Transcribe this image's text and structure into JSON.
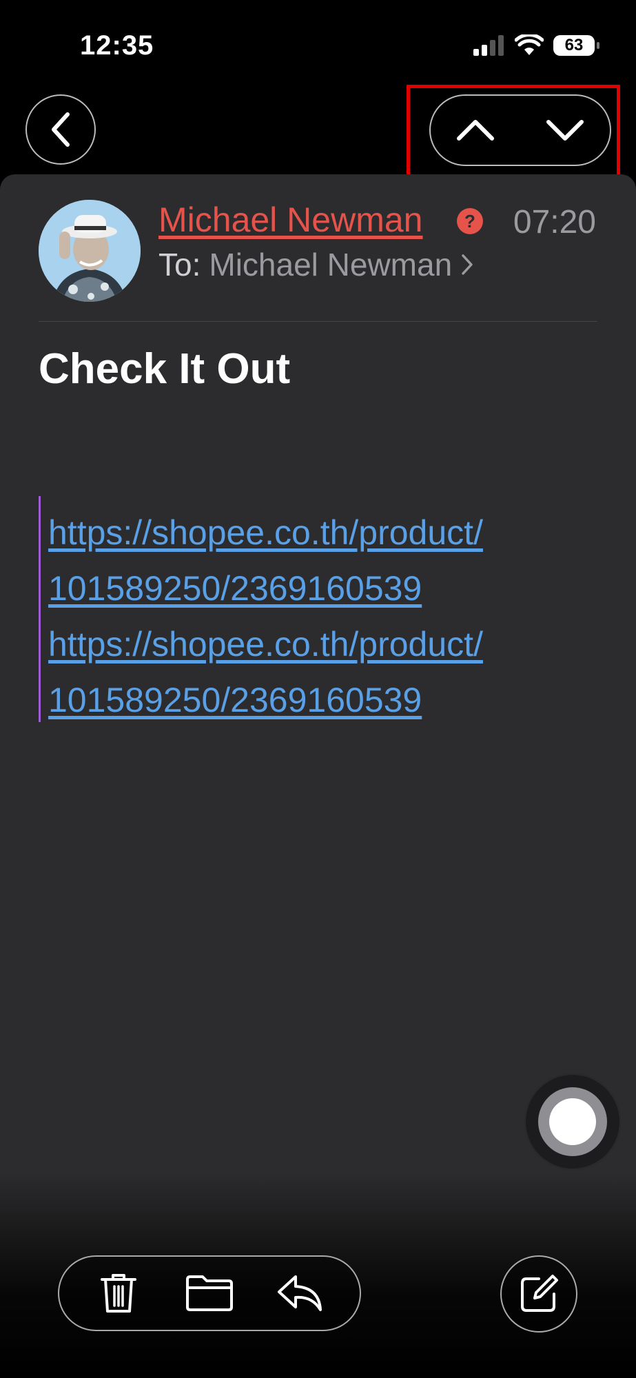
{
  "status": {
    "time": "12:35",
    "battery": "63"
  },
  "nav": {
    "back_icon": "chevron-left-icon",
    "prev_icon": "chevron-up-icon",
    "next_icon": "chevron-down-icon"
  },
  "email": {
    "sender": "Michael Newman",
    "time": "07:20",
    "to_label": "To:",
    "to_name": "Michael Newman",
    "subject": "Check It Out",
    "links": [
      "https://shopee.co.th/product/",
      "101589250/2369160539",
      "https://shopee.co.th/product/",
      "101589250/2369160539"
    ]
  },
  "toolbar": {
    "items": [
      "trash-icon",
      "folder-icon",
      "reply-icon"
    ],
    "compose": "compose-icon"
  },
  "colors": {
    "sender": "#e5534b",
    "link": "#5aa0e6",
    "quote_bar": "#a05bd6",
    "highlight": "#e00000"
  }
}
